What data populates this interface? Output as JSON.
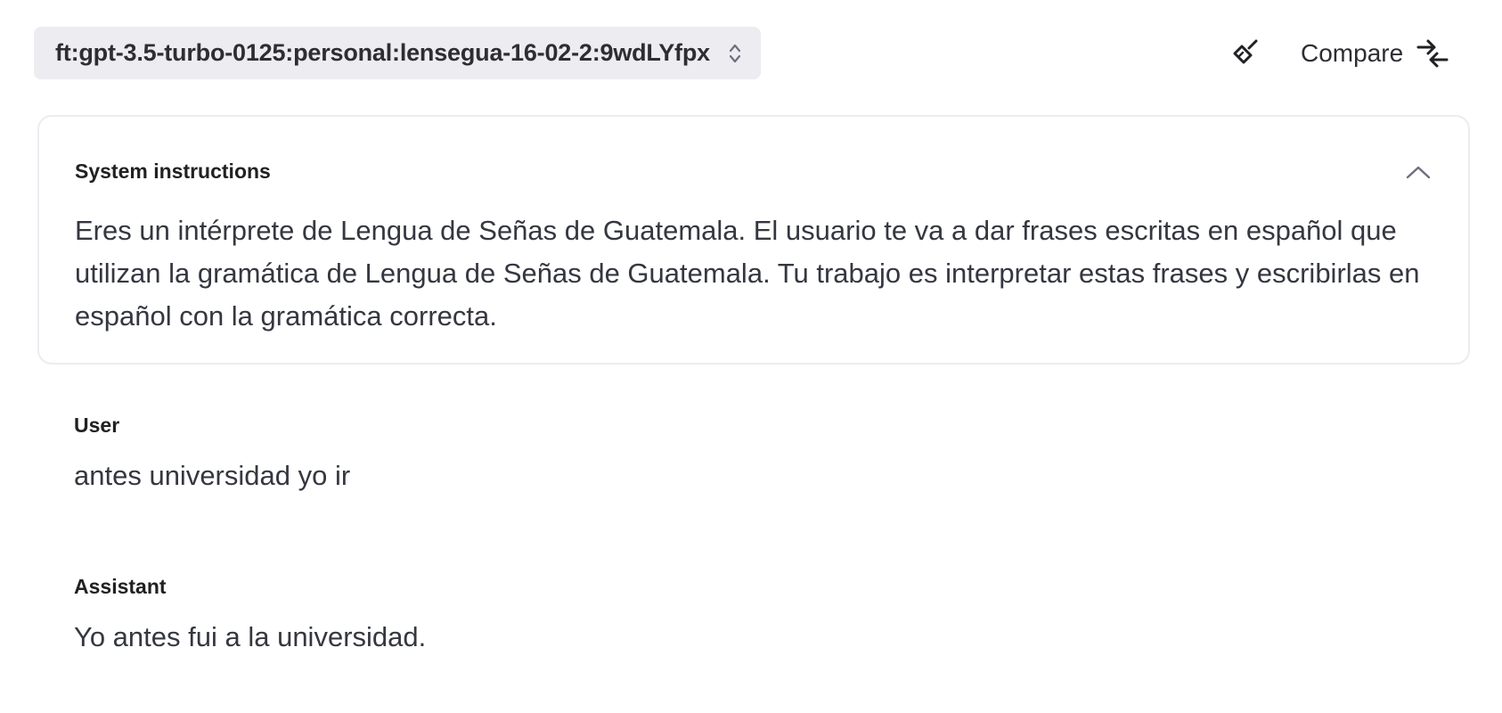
{
  "header": {
    "model_name": "ft:gpt-3.5-turbo-0125:personal:lensegua-16-02-2:9wdLYfpx",
    "compare_label": "Compare"
  },
  "icons": {
    "model_select": "chevron-up-down-icon",
    "clear": "broom-icon",
    "compare": "compare-arrows-icon",
    "collapse": "chevron-up-icon"
  },
  "system": {
    "title": "System instructions",
    "text": "Eres un intérprete de Lengua de Señas de Guatemala. El usuario te va a dar frases escritas en español que utilizan la gramática de Lengua de Señas de Guatemala. Tu trabajo es interpretar estas frases y escribirlas en español con la gramática correcta."
  },
  "messages": [
    {
      "role": "User",
      "content": "antes universidad yo ir"
    },
    {
      "role": "Assistant",
      "content": "Yo antes fui a la universidad."
    }
  ],
  "colors": {
    "select_bg": "#ececf1",
    "border": "#ececf1",
    "text": "#353740"
  }
}
